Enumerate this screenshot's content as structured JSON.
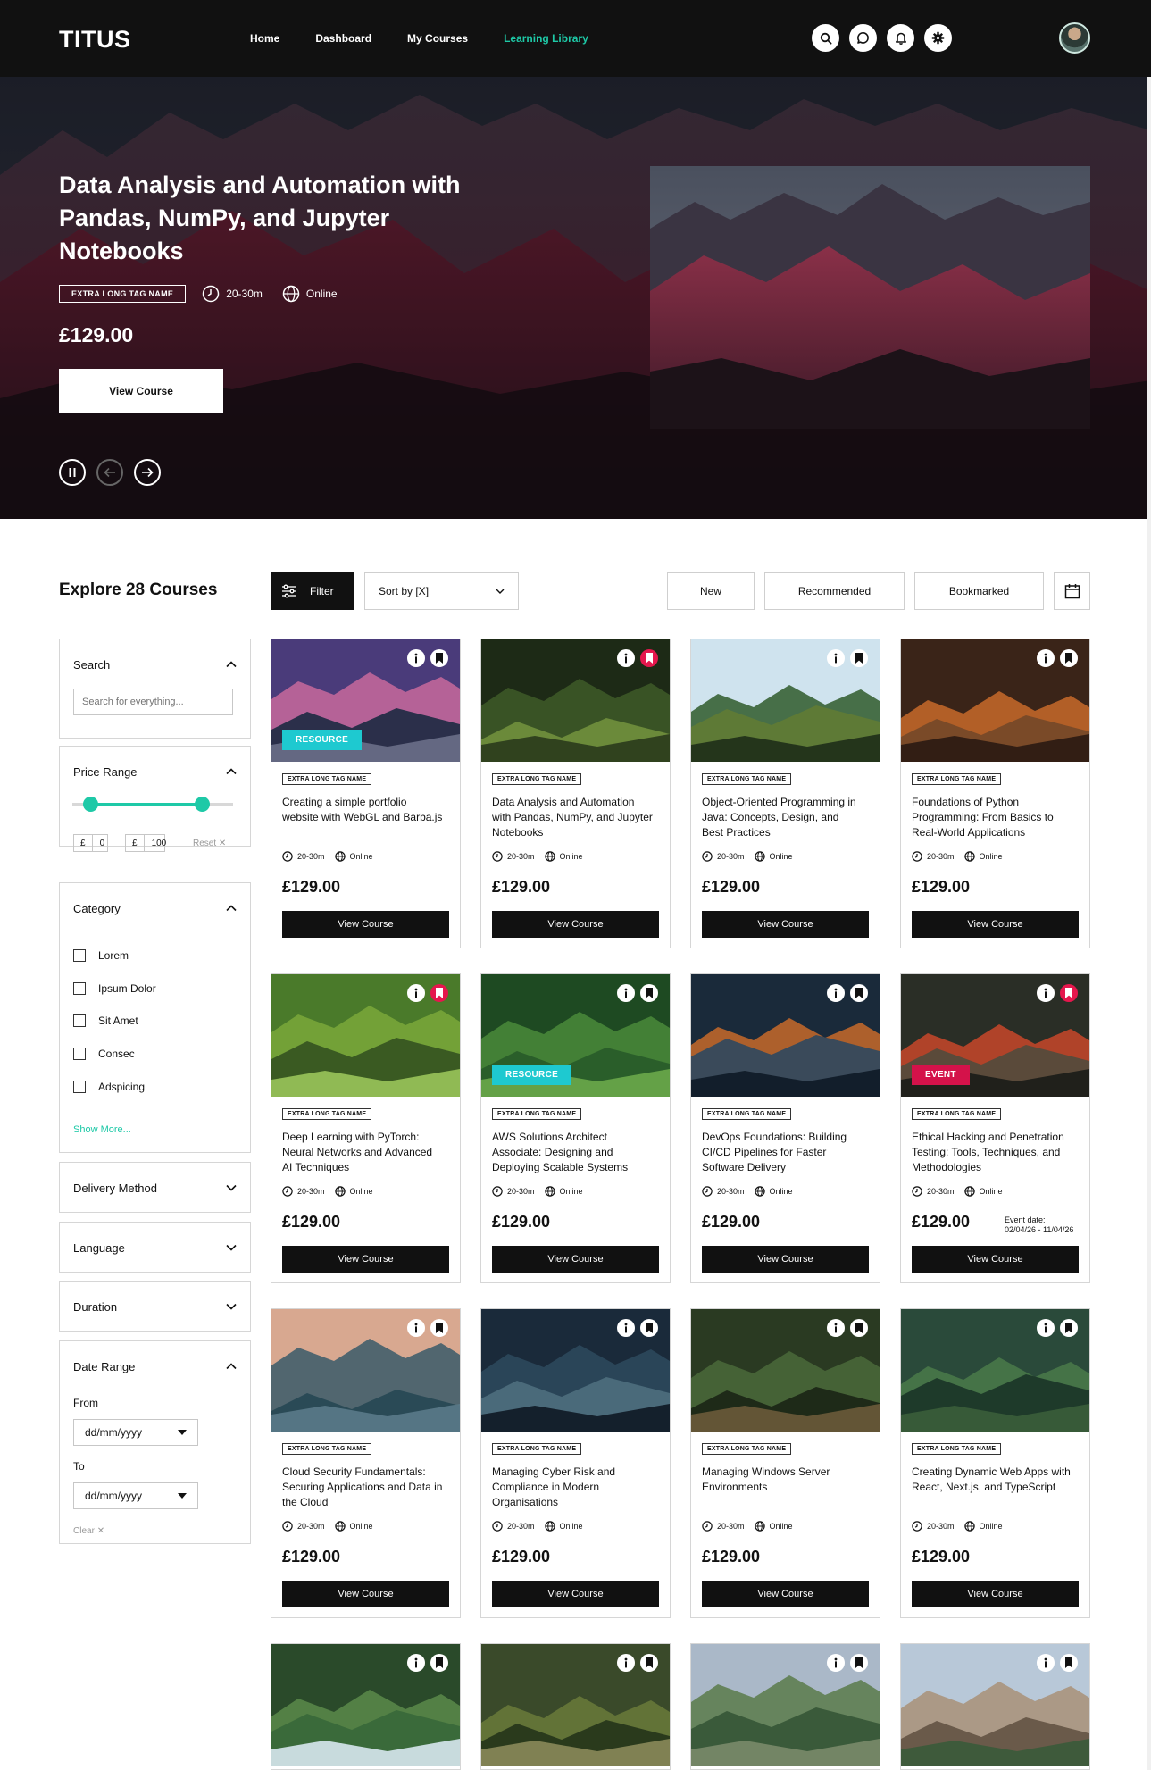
{
  "nav": {
    "logo": "TITUS",
    "links": [
      {
        "label": "Home",
        "active": false
      },
      {
        "label": "Dashboard",
        "active": false
      },
      {
        "label": "My Courses",
        "active": false
      },
      {
        "label": "Learning Library",
        "active": true
      }
    ],
    "icons": [
      "search-icon",
      "chat-icon",
      "bell-icon",
      "gear-icon"
    ],
    "accent_color": "#1ec9a7"
  },
  "hero": {
    "title": "Data Analysis and Automation with Pandas, NumPy, and Jupyter Notebooks",
    "tag": "EXTRA LONG TAG NAME",
    "duration": "20-30m",
    "delivery": "Online",
    "price": "£129.00",
    "button_label": "View Course"
  },
  "toolbar": {
    "explore_title": "Explore 28 Courses",
    "filter_label": "Filter",
    "sort_label": "Sort by [X]",
    "tabs": [
      "New",
      "Recommended",
      "Bookmarked"
    ]
  },
  "sidebar": {
    "search": {
      "title": "Search",
      "placeholder": "Search for everything..."
    },
    "price": {
      "title": "Price Range",
      "currency": "£",
      "min": "0",
      "max": "100",
      "reset": "Reset"
    },
    "category": {
      "title": "Category",
      "items": [
        "Lorem",
        "Ipsum Dolor",
        "Sit Amet",
        "Consec",
        "Adspicing"
      ],
      "show_more": "Show More..."
    },
    "delivery": {
      "title": "Delivery Method"
    },
    "language": {
      "title": "Language"
    },
    "duration": {
      "title": "Duration"
    },
    "date_range": {
      "title": "Date Range",
      "from_label": "From",
      "to_label": "To",
      "placeholder": "dd/mm/yyyy",
      "clear": "Clear"
    }
  },
  "colors": {
    "resource_badge": "#1ec9d0",
    "event_badge": "#d4124a",
    "bookmark_active": "#e5174d"
  },
  "cards": [
    {
      "title": "Creating a simple portfolio website with WebGL and Barba.js",
      "tag": "EXTRA LONG TAG NAME",
      "duration": "20-30m",
      "delivery": "Online",
      "price": "£129.00",
      "button": "View Course",
      "badge": "RESOURCE",
      "bookmarked": false
    },
    {
      "title": "Data Analysis and Automation with Pandas, NumPy, and Jupyter Notebooks",
      "tag": "EXTRA LONG TAG NAME",
      "duration": "20-30m",
      "delivery": "Online",
      "price": "£129.00",
      "button": "View Course",
      "badge": "",
      "bookmarked": true
    },
    {
      "title": "Object-Oriented Programming in Java: Concepts, Design, and Best Practices",
      "tag": "EXTRA LONG TAG NAME",
      "duration": "20-30m",
      "delivery": "Online",
      "price": "£129.00",
      "button": "View Course",
      "badge": "",
      "bookmarked": false
    },
    {
      "title": "Foundations of Python Programming: From Basics to Real-World Applications",
      "tag": "EXTRA LONG TAG NAME",
      "duration": "20-30m",
      "delivery": "Online",
      "price": "£129.00",
      "button": "View Course",
      "badge": "",
      "bookmarked": false
    },
    {
      "title": "Deep Learning with PyTorch: Neural Networks and Advanced AI Techniques",
      "tag": "EXTRA LONG TAG NAME",
      "duration": "20-30m",
      "delivery": "Online",
      "price": "£129.00",
      "button": "View Course",
      "badge": "",
      "bookmarked": true
    },
    {
      "title": "AWS Solutions Architect Associate: Designing and Deploying Scalable Systems",
      "tag": "EXTRA LONG TAG NAME",
      "duration": "20-30m",
      "delivery": "Online",
      "price": "£129.00",
      "button": "View Course",
      "badge": "RESOURCE",
      "bookmarked": false
    },
    {
      "title": "DevOps Foundations: Building CI/CD Pipelines for Faster Software Delivery",
      "tag": "EXTRA LONG TAG NAME",
      "duration": "20-30m",
      "delivery": "Online",
      "price": "£129.00",
      "button": "View Course",
      "badge": "",
      "bookmarked": false
    },
    {
      "title": "Ethical Hacking and Penetration Testing: Tools, Techniques, and Methodologies",
      "tag": "EXTRA LONG TAG NAME",
      "duration": "20-30m",
      "delivery": "Online",
      "price": "£129.00",
      "button": "View Course",
      "badge": "EVENT",
      "bookmarked": true,
      "event_label": "Event date:",
      "event_dates": "02/04/26 - 11/04/26"
    },
    {
      "title": "Cloud Security Fundamentals: Securing Applications and Data in the Cloud",
      "tag": "EXTRA LONG TAG NAME",
      "duration": "20-30m",
      "delivery": "Online",
      "price": "£129.00",
      "button": "View Course",
      "badge": "",
      "bookmarked": false
    },
    {
      "title": "Managing Cyber Risk and Compliance in Modern Organisations",
      "tag": "EXTRA LONG TAG NAME",
      "duration": "20-30m",
      "delivery": "Online",
      "price": "£129.00",
      "button": "View Course",
      "badge": "",
      "bookmarked": false
    },
    {
      "title": "Managing Windows Server Environments",
      "tag": "EXTRA LONG TAG NAME",
      "duration": "20-30m",
      "delivery": "Online",
      "price": "£129.00",
      "button": "View Course",
      "badge": "",
      "bookmarked": false
    },
    {
      "title": "Creating Dynamic Web Apps with React, Next.js, and TypeScript",
      "tag": "EXTRA LONG TAG NAME",
      "duration": "20-30m",
      "delivery": "Online",
      "price": "£129.00",
      "button": "View Course",
      "badge": "",
      "bookmarked": false
    }
  ]
}
